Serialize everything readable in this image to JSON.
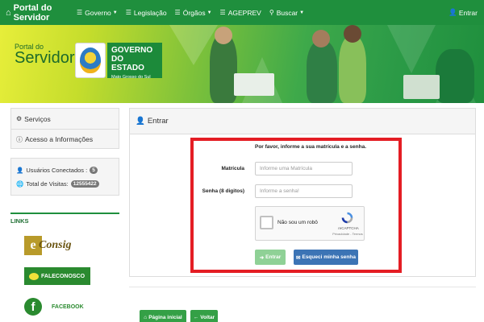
{
  "navbar": {
    "brand": "Portal do Servidor",
    "items": [
      {
        "label": "Governo",
        "icon": "list-icon",
        "dropdown": true
      },
      {
        "label": "Legislação",
        "icon": "list-icon",
        "dropdown": false
      },
      {
        "label": "Órgãos",
        "icon": "list-icon",
        "dropdown": true
      },
      {
        "label": "AGEPREV",
        "icon": "list-icon",
        "dropdown": false
      },
      {
        "label": "Buscar",
        "icon": "search-icon",
        "dropdown": true
      }
    ],
    "login": "Entrar"
  },
  "banner": {
    "portal_small": "Portal do",
    "servidor": "Servidor",
    "gov_line1": "GOVERNO",
    "gov_line2": "DO ESTADO",
    "gov_sub": "Mato Grosso do Sul"
  },
  "sidebar": {
    "menu": [
      {
        "label": "Serviços",
        "icon": "gear-icon"
      },
      {
        "label": "Acesso a Informações",
        "icon": "info-icon"
      }
    ],
    "stats": {
      "users_label": "Usuários Conectados :",
      "users_value": "5",
      "visits_label": "Total de Visitas:",
      "visits_value": "12555422"
    },
    "links_title": "LINKS",
    "links": {
      "consig_e": "e",
      "consig_text": "Consig",
      "fale": "FALECONOSCO",
      "facebook_f": "f",
      "facebook": "FACEBOOK"
    }
  },
  "panel": {
    "title": "Entrar",
    "message": "Por favor, informe a sua matrícula e a senha.",
    "matricula_label": "Matrícula",
    "matricula_placeholder": "Informe uma Matrícula",
    "senha_label": "Senha (8 digitos)",
    "senha_placeholder": "Informe a senha!",
    "captcha_text": "Não sou um robô",
    "captcha_brand": "reCAPTCHA",
    "captcha_links": "Privacidade - Termos",
    "btn_entrar": "Entrar",
    "btn_esqueci": "Esqueci minha senha"
  },
  "footer_buttons": {
    "home": "Página inicial",
    "back": "Voltar"
  },
  "colors": {
    "primary_green": "#1f8f3d",
    "highlight_red": "#e41d24",
    "button_blue": "#3c74b5"
  }
}
